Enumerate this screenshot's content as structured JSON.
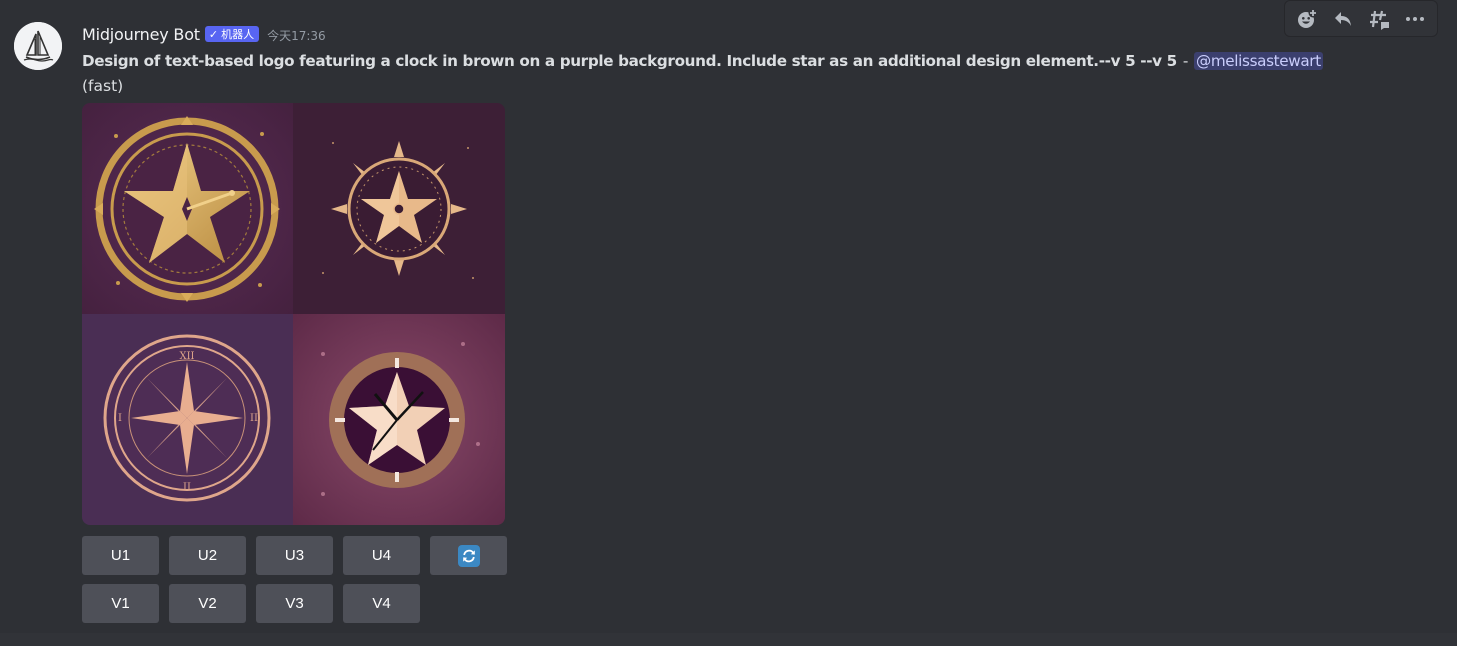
{
  "message": {
    "author": "Midjourney Bot",
    "bot_tag": "机器人",
    "bot_tag_check": "✓",
    "timestamp": "今天17:36",
    "prompt": "Design of text-based logo featuring a clock in brown on a purple background. Include star as an additional design element.--v 5 --v 5",
    "separator": "-",
    "mention": "@melissastewart",
    "speed": "(fast)"
  },
  "images": {
    "tiles": [
      "tile-1",
      "tile-2",
      "tile-3",
      "tile-4"
    ]
  },
  "buttons": {
    "upscale": [
      "U1",
      "U2",
      "U3",
      "U4"
    ],
    "variation": [
      "V1",
      "V2",
      "V3",
      "V4"
    ],
    "reroll_icon": "refresh-icon"
  },
  "toolbar": {
    "icons": [
      "add-reaction-icon",
      "reply-icon",
      "create-thread-icon",
      "more-options-icon"
    ]
  },
  "colors": {
    "background": "#2e3035",
    "button": "#4e5058",
    "bot_tag": "#5865f2",
    "mention_bg": "#3c4270",
    "refresh": "#3b88c3"
  }
}
